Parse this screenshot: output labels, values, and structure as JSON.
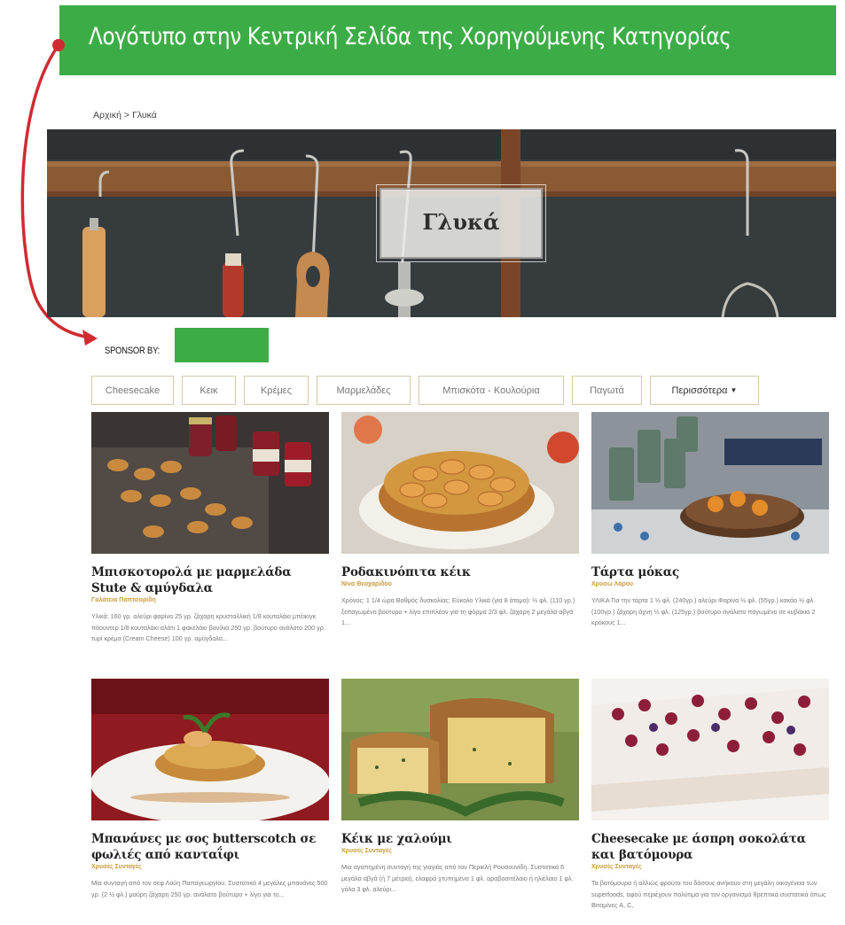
{
  "annotation": {
    "banner_text": "Λογότυπο στην Κεντρική Σελίδα της Χορηγούμενης Κατηγορίας",
    "banner_color": "#3cad46",
    "arrow_color": "#cf2b32"
  },
  "breadcrumb": {
    "home": "Αρχική",
    "separator": ">",
    "current": "Γλυκά"
  },
  "hero": {
    "title": "Γλυκά"
  },
  "sponsor": {
    "label": "SPONSOR BY:",
    "logo_color": "#3cad46"
  },
  "tabs": [
    {
      "label": "Cheesecake"
    },
    {
      "label": "Κεικ"
    },
    {
      "label": "Κρέμες"
    },
    {
      "label": "Μαρμελάδες"
    },
    {
      "label": "Μπισκότα - Κουλούρια"
    },
    {
      "label": "Παγωτά"
    },
    {
      "label": "Περισσότερα",
      "icon": "chevron-down-icon"
    }
  ],
  "recipes": [
    {
      "title": "Μπισκοτορολά με μαρμελάδα Stute & αμύγδαλα",
      "author": "Γαλάτεια Παπτσορίδη",
      "description": "Υλικά: 160 γρ. αλεύρι φαρίνα 25 γρ. ζάχαρη κρυσταλλική 1/8 κουταλάκι μπέικιγκ πάουντερ 1/8 κουταλάκι αλάτι 1 φακελάκι βανίλια 250 γρ. βούτυρο ανάλατο 200 γρ. τυρί κρέμα (Cream Cheese) 100 γρ. αμύγδαλα..."
    },
    {
      "title": "Ροδακινόπιτα κέικ",
      "author": "Νίνα Θεοχαρίδου",
      "description": "Χρόνος: 1 1/4 ώρα Βαθμός δυσκολίας: Εύκολο Υλικά (για 8 άτομα): ½ φλ. (110 γρ.) ξεπαγωμένο βούτυρο + λίγο επιπλέον για τη φόρμα 2/3 φλ. ζάχαρη 2 μεγάλα αβγά 1..."
    },
    {
      "title": "Τάρτα μόκας",
      "author": "Χρύσω Λάρου",
      "description": "ΥΛΙΚΑ Για την τάρτα 1 ½ φλ. (240γρ.) αλεύρι Φαρίνα ½ φλ. (55γρ.) κακάο ½ φλ. (100γρ.) ζάχαρη άχνη ½ φλ. (125γρ.) βούτυρο ανάλατο παγωμένο σε κυβάκια 2 κρόκους 1..."
    },
    {
      "title": "Μπανάνες με σος butterscotch σε φωλιές από κανταΐφι",
      "author": "Χρυσές Συνταγές",
      "description": "Μία συνταγή από τον σεφ Λούη Παπαγεωργίου. Συστατικά 4 μεγάλες μπανάνες 500 γρ. (2 ½ φλ.) μαύρη ζάχαρη 250 γρ. ανάλατο βούτυρο + λίγο για το..."
    },
    {
      "title": "Κέικ με χαλούμι",
      "author": "Χρυσές Συνταγές",
      "description": "Μια αγαπημένη συνταγή της γιαγιάς από τον Περικλή Ρουσουνίδη. Συστατικά 6 μεγάλα αβγά (ή 7 μέτρια), ελαφρά χτυπημένα 1 φλ. αραβοσιτέλαιο ή ηλιέλαιο 1 φλ. γάλα 3 φλ. αλεύρι..."
    },
    {
      "title": "Cheesecake με άσπρη σοκολάτα και βατόμουρα",
      "author": "Χρυσές Συνταγές",
      "description": "Τα βατόμουρα ή αλλιώς φρούτα του δάσους ανήκουν στη μεγάλη οικογένεια των superfoods, αφού περιέχουν πολύτιμα για τον οργανισμό θρεπτικά συστατικά όπως Βιταμίνες A, C,"
    }
  ]
}
